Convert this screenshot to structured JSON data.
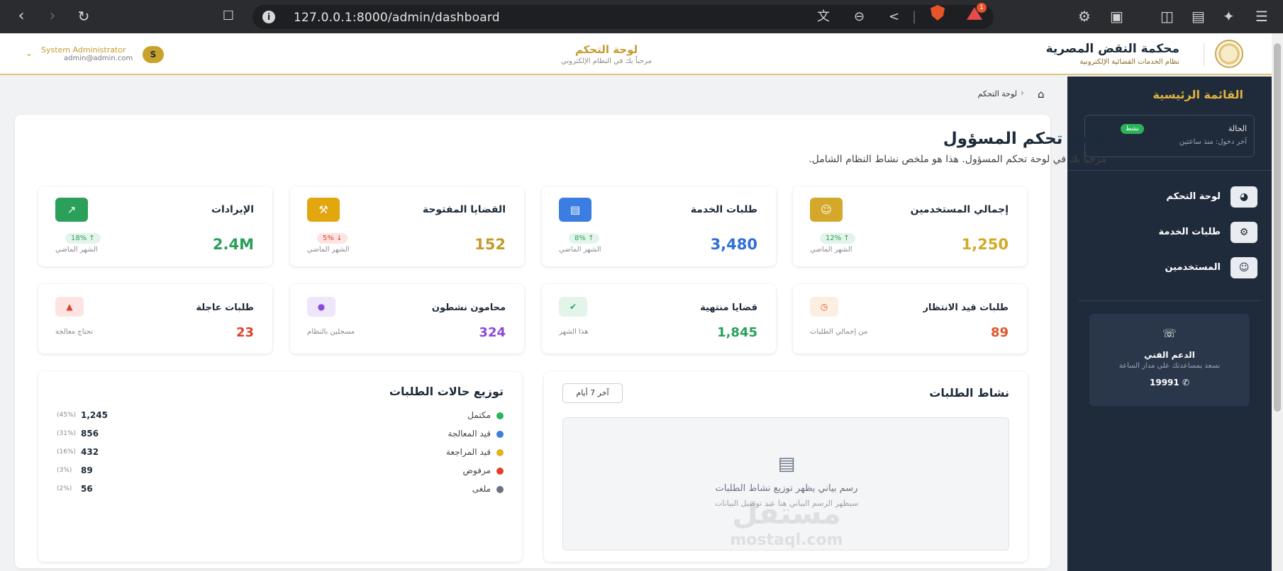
{
  "browser": {
    "url": "127.0.0.1:8000/admin/dashboard",
    "notification_count": "1"
  },
  "header": {
    "court_name": "محكمة النقض المصرية",
    "court_subtitle": "نظام الخدمات القضائية الإلكترونية",
    "title": "لوحة التحكم",
    "subtitle": "مرحباً بك في النظام الإلكتروني",
    "user_initial": "S",
    "user_name": "System Administrator",
    "user_email": "admin@admin.com"
  },
  "sidebar": {
    "title": "القائمة الرئيسية",
    "status_label": "الحالة",
    "status_badge": "نشط",
    "last_login": "آخر دخول: منذ ساعتين",
    "items": [
      {
        "label": "لوحة التحكم",
        "icon": "gauge-icon"
      },
      {
        "label": "طلبات الخدمة",
        "icon": "gears-icon"
      },
      {
        "label": "المستخدمين",
        "icon": "users-icon"
      }
    ],
    "support": {
      "title": "الدعم الفني",
      "subtitle": "نسعد بمساعدتك على مدار الساعة",
      "phone": "19991"
    }
  },
  "breadcrumb": {
    "current": "لوحة التحكم"
  },
  "page": {
    "title": "لوحة تحكم المسؤول",
    "subtitle": "مرحباً بك في لوحة تحكم المسؤول. هذا هو ملخص نشاط النظام الشامل."
  },
  "stats": [
    {
      "title": "إجمالي المستخدمين",
      "value": "1,250",
      "change": "12%",
      "direction": "up",
      "caption": "الشهر الماضي",
      "icon": "users-icon",
      "color": "#d4a82b"
    },
    {
      "title": "طلبات الخدمة",
      "value": "3,480",
      "change": "8%",
      "direction": "up",
      "caption": "الشهر الماضي",
      "icon": "clipboard-icon",
      "color": "#3b7de0"
    },
    {
      "title": "القضايا المفتوحة",
      "value": "152",
      "change": "5%",
      "direction": "down",
      "caption": "الشهر الماضي",
      "icon": "gavel-icon",
      "color": "#e2a60f"
    },
    {
      "title": "الإيرادات",
      "value": "2.4M",
      "change": "18%",
      "direction": "up",
      "caption": "الشهر الماضي",
      "icon": "chart-line-icon",
      "color": "#2aa05a"
    }
  ],
  "small_stats": [
    {
      "title": "طلبات قيد الانتظار",
      "value": "89",
      "caption": "من إجمالي الطلبات",
      "icon": "clock-icon",
      "color": "#e0572a",
      "bg": "#fdeee2"
    },
    {
      "title": "قضايا منتهية",
      "value": "1,845",
      "caption": "هذا الشهر",
      "icon": "check-icon",
      "color": "#2aa05a",
      "bg": "#e3f5ea"
    },
    {
      "title": "محامون نشطون",
      "value": "324",
      "caption": "مسجلين بالنظام",
      "icon": "user-icon",
      "color": "#8a4ad8",
      "bg": "#efe6fb"
    },
    {
      "title": "طلبات عاجلة",
      "value": "23",
      "caption": "تحتاج معالجة",
      "icon": "warning-icon",
      "color": "#e0402a",
      "bg": "#fde4e2"
    }
  ],
  "activity": {
    "title": "نشاط الطلبات",
    "range": "آخر 7 أيام",
    "placeholder_title": "رسم بياني يظهر توزيع نشاط الطلبات",
    "placeholder_hint": "سيظهر الرسم البياني هنا عند توصيل البيانات"
  },
  "distribution": {
    "title": "توزيع حالات الطلبات",
    "rows": [
      {
        "label": "مكتمل",
        "count": "1,245",
        "pct": "(45%)",
        "color": "#2bb35a"
      },
      {
        "label": "قيد المعالجة",
        "count": "856",
        "pct": "(31%)",
        "color": "#3b7de0"
      },
      {
        "label": "قيد المراجعة",
        "count": "432",
        "pct": "(16%)",
        "color": "#e2b31a"
      },
      {
        "label": "مرفوض",
        "count": "89",
        "pct": "(3%)",
        "color": "#e0402a"
      },
      {
        "label": "ملغى",
        "count": "56",
        "pct": "(2%)",
        "color": "#6b7280"
      }
    ]
  },
  "watermark": {
    "arabic": "مستقل",
    "latin": "mostaql.com"
  }
}
